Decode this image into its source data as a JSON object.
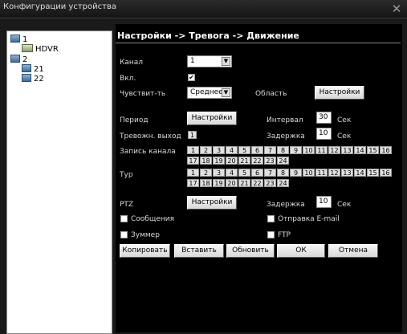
{
  "window": {
    "title": "Конфигурации устройства"
  },
  "tree": [
    {
      "label": "1",
      "type": "folder"
    },
    {
      "label": "HDVR",
      "type": "dvr"
    },
    {
      "label": "2",
      "type": "folder"
    },
    {
      "label": "21",
      "type": "folder"
    },
    {
      "label": "22",
      "type": "folder"
    }
  ],
  "panel": {
    "title": "Настройки -> Тревога -> Движение",
    "channel_label": "Канал",
    "channel_value": "1",
    "enable_label": "Вкл.",
    "sensitivity_label": "Чувствит-ть",
    "sensitivity_value": "Среднее",
    "region_label": "Область",
    "region_button": "Настройки",
    "period_label": "Период",
    "period_button": "Настройки",
    "interval_label": "Интервал",
    "interval_value": "30",
    "sec_label": "Сек",
    "alarm_out_label": "Тревожн. выход",
    "delay_label": "Задержка",
    "delay_value": "10",
    "record_label": "Запись канала",
    "tour_label": "Тур",
    "channels": [
      "1",
      "2",
      "3",
      "4",
      "5",
      "6",
      "7",
      "8",
      "9",
      "10",
      "11",
      "12",
      "13",
      "14",
      "15",
      "16",
      "17",
      "18",
      "19",
      "20",
      "21",
      "22",
      "23",
      "24"
    ],
    "ptz_label": "PTZ",
    "ptz_button": "Настройки",
    "ptz_delay_value": "10",
    "messages_label": "Сообщения",
    "email_label": "Отправка E-mail",
    "buzzer_label": "Зуммер",
    "ftp_label": "FTP",
    "buttons": {
      "copy": "Копировать",
      "paste": "Вставить",
      "refresh": "Обновить",
      "ok": "ОК",
      "cancel": "Отмена"
    }
  }
}
